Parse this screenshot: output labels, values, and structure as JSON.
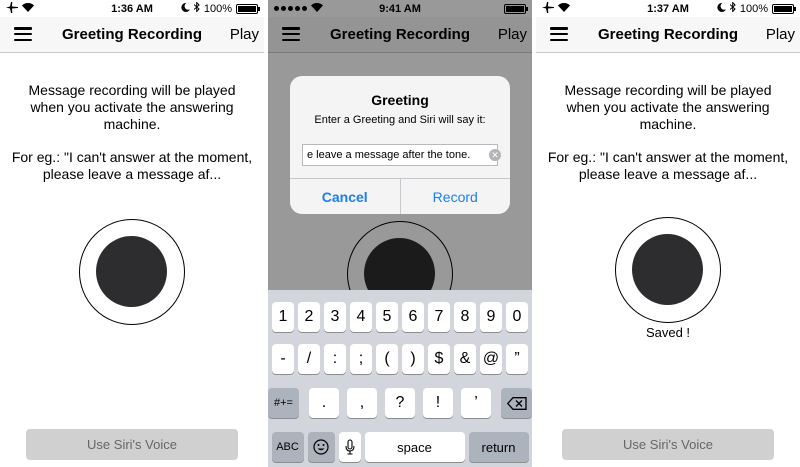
{
  "phones": [
    {
      "status": {
        "time": "1:36 AM",
        "battery": "100%",
        "battery_level": 1.0
      },
      "nav": {
        "title": "Greeting Recording",
        "play_label": "Play"
      },
      "message": "Message recording will be played when you activate the answering machine.",
      "example": "For eg.: \"I can't answer at the moment, please leave a message af...",
      "siri_button": "Use Siri's Voice"
    },
    {
      "status": {
        "time": "9:41 AM",
        "battery_level": 1.0
      },
      "nav": {
        "title": "Greeting Recording",
        "play_label": "Play"
      },
      "alert": {
        "title": "Greeting",
        "message": "Enter a Greeting and Siri will say it:",
        "field_value": "e leave a message after the tone.",
        "cancel_label": "Cancel",
        "record_label": "Record"
      },
      "keyboard": {
        "row1": [
          "1",
          "2",
          "3",
          "4",
          "5",
          "6",
          "7",
          "8",
          "9",
          "0"
        ],
        "row2": [
          "-",
          "/",
          ":",
          ";",
          "(",
          ")",
          "$",
          "&",
          "@",
          "”"
        ],
        "row3_switch": "#+=",
        "row3": [
          ".",
          ",",
          "?",
          "!",
          "’"
        ],
        "abc": "ABC",
        "space": "space",
        "return": "return"
      }
    },
    {
      "status": {
        "time": "1:37 AM",
        "battery": "100%",
        "battery_level": 1.0
      },
      "nav": {
        "title": "Greeting Recording",
        "play_label": "Play"
      },
      "message": "Message recording will be played when you activate the answering machine.",
      "example": "For eg.: \"I can't answer at the moment, please leave a message af...",
      "saved": "Saved !",
      "siri_button": "Use Siri's Voice"
    }
  ],
  "colors": {
    "accent": "#1a7ef5",
    "record_dot": "#2d2d2f",
    "disabled_button": "#d0d0d0"
  },
  "icons": [
    "airplane-icon",
    "wifi-icon",
    "moon-icon",
    "bluetooth-icon",
    "battery-icon",
    "hamburger-menu-icon",
    "clear-text-icon",
    "emoji-icon",
    "microphone-icon",
    "backspace-icon"
  ]
}
